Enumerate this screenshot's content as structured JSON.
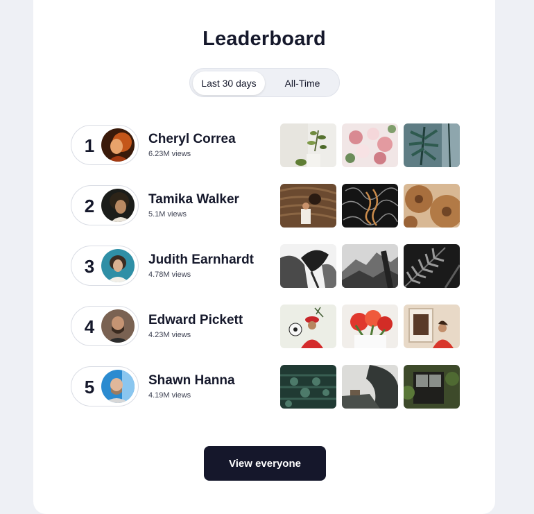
{
  "header": {
    "title": "Leaderboard"
  },
  "period_toggle": {
    "options": [
      "Last 30 days",
      "All-Time"
    ],
    "selected": "Last 30 days"
  },
  "leaders": [
    {
      "rank": "1",
      "name": "Cheryl Correa",
      "views": "6.23M views"
    },
    {
      "rank": "2",
      "name": "Tamika Walker",
      "views": "5.1M views"
    },
    {
      "rank": "3",
      "name": "Judith Earnhardt",
      "views": "4.78M views"
    },
    {
      "rank": "4",
      "name": "Edward Pickett",
      "views": "4.23M views"
    },
    {
      "rank": "5",
      "name": "Shawn Hanna",
      "views": "4.19M views"
    }
  ],
  "footer": {
    "cta_label": "View everyone"
  },
  "colors": {
    "primary": "#15172b",
    "background": "#eef0f5",
    "card": "#ffffff"
  }
}
